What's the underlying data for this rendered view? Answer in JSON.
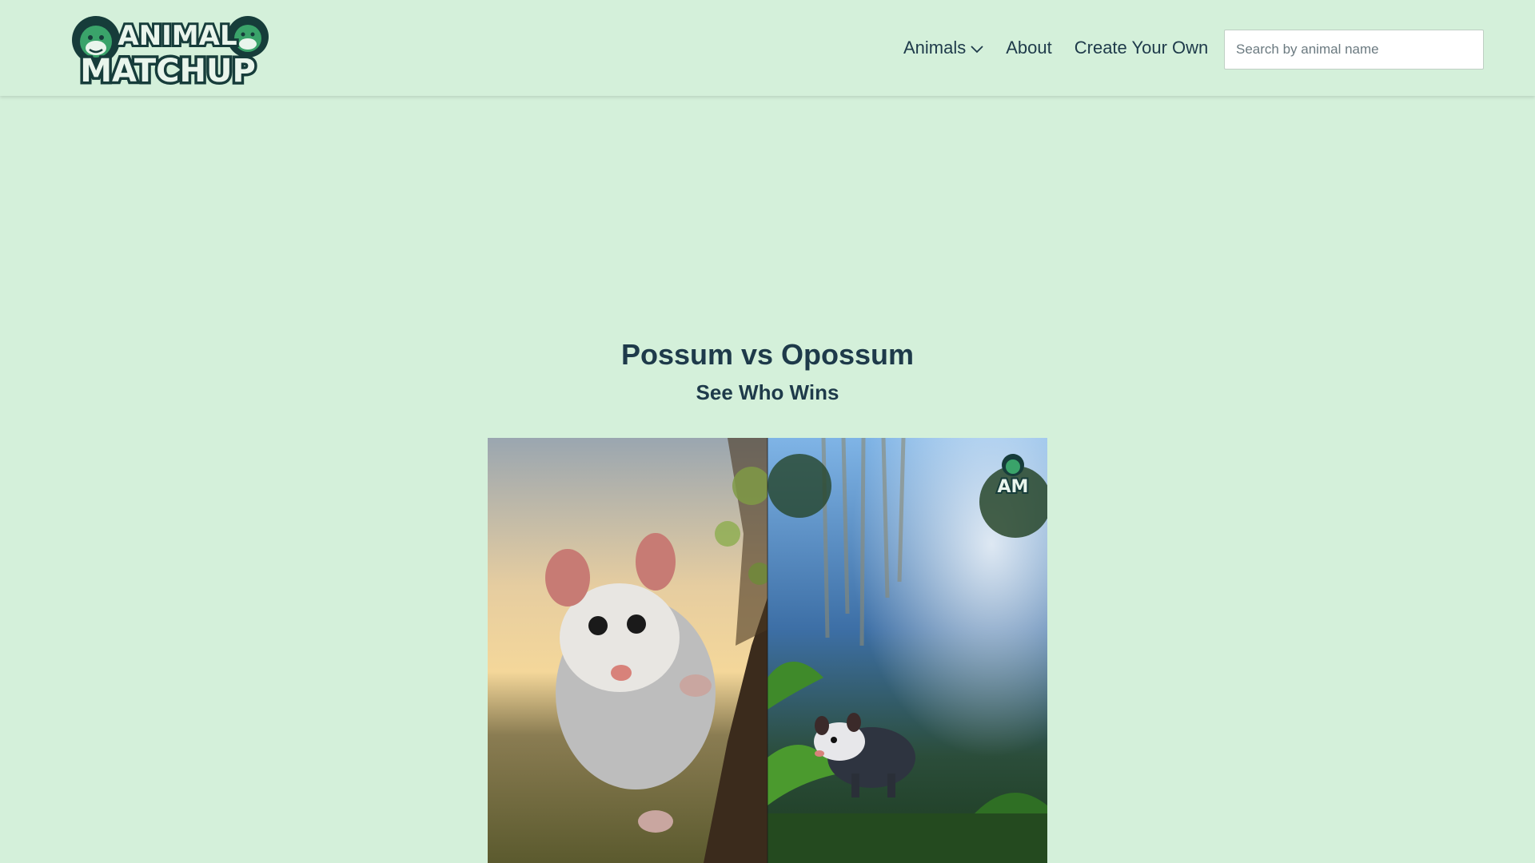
{
  "header": {
    "logo": {
      "line1": "ANIMAL",
      "line2": "MATCHUP"
    },
    "nav": [
      {
        "label": "Animals",
        "has_dropdown": true,
        "icon": "chevron-down-icon"
      },
      {
        "label": "About"
      },
      {
        "label": "Create Your Own"
      }
    ],
    "search": {
      "placeholder": "Search by animal name",
      "value": ""
    }
  },
  "main": {
    "title": "Possum vs Opossum",
    "subtitle": "See Who Wins",
    "hero_image": {
      "left": "possum-on-tree-at-sunset",
      "right": "opossum-in-rainforest",
      "watermark": "AM"
    }
  },
  "colors": {
    "background": "#d4f0da",
    "text": "#1e3a4a",
    "logo_green": "#2f8f5b",
    "logo_dark": "#163c3a"
  }
}
